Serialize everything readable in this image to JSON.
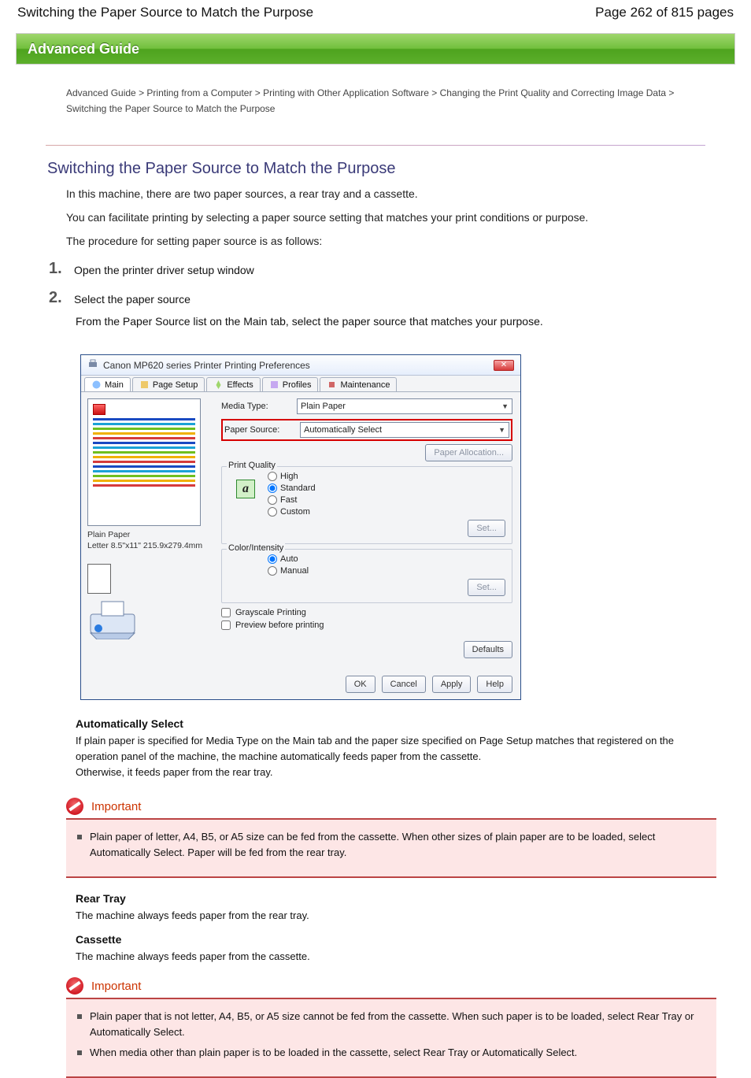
{
  "header": {
    "left": "Switching the Paper Source to Match the Purpose",
    "right": "Page 262 of 815 pages"
  },
  "guide_bar": "Advanced Guide",
  "breadcrumb": "Advanced Guide > Printing from a Computer > Printing with Other Application Software > Changing the Print Quality and Correcting Image Data > Switching the Paper Source to Match the Purpose",
  "page_title": "Switching the Paper Source to Match the Purpose",
  "intro": [
    "In this machine, there are two paper sources, a rear tray and a cassette.",
    "You can facilitate printing by selecting a paper source setting that matches your print conditions or purpose.",
    "The procedure for setting paper source is as follows:"
  ],
  "step1": {
    "num": "1.",
    "title": "Open the printer driver setup window"
  },
  "step2": {
    "num": "2.",
    "title": "Select the paper source",
    "desc": "From the Paper Source list on the Main tab, select the paper source that matches your purpose."
  },
  "dialog": {
    "title": "Canon MP620 series Printer Printing Preferences",
    "tabs": [
      "Main",
      "Page Setup",
      "Effects",
      "Profiles",
      "Maintenance"
    ],
    "media_type_label": "Media Type:",
    "media_type_value": "Plain Paper",
    "paper_source_label": "Paper Source:",
    "paper_source_value": "Automatically Select",
    "paper_allocation_btn": "Paper Allocation...",
    "print_quality_label": "Print Quality",
    "quality_options": [
      "High",
      "Standard",
      "Fast",
      "Custom"
    ],
    "set_btn": "Set...",
    "color_intensity_label": "Color/Intensity",
    "color_options": [
      "Auto",
      "Manual"
    ],
    "grayscale_label": "Grayscale Printing",
    "preview_label": "Preview before printing",
    "defaults_btn": "Defaults",
    "ok_btn": "OK",
    "cancel_btn": "Cancel",
    "apply_btn": "Apply",
    "help_btn": "Help",
    "preview_text_1": "Plain Paper",
    "preview_text_2": "Letter 8.5\"x11\" 215.9x279.4mm"
  },
  "auto_select": {
    "heading": "Automatically Select",
    "body1": "If plain paper is specified for Media Type on the Main tab and the paper size specified on Page Setup matches that registered on the operation panel of the machine, the machine automatically feeds paper from the cassette.",
    "body2": "Otherwise, it feeds paper from the rear tray."
  },
  "important1": {
    "title": "Important",
    "line1": "Plain paper of letter, A4, B5, or A5 size can be fed from the cassette. When other sizes of plain paper are to be loaded, select Automatically Select. Paper will be fed from the rear tray."
  },
  "rear_tray": {
    "heading": "Rear Tray",
    "body": "The machine always feeds paper from the rear tray."
  },
  "cassette": {
    "heading": "Cassette",
    "body": "The machine always feeds paper from the cassette."
  },
  "important2": {
    "title": "Important",
    "line1": "Plain paper that is not letter, A4, B5, or A5 size cannot be fed from the cassette. When such paper is to be loaded, select Rear Tray or Automatically Select.",
    "line2": "When media other than plain paper is to be loaded in the cassette, select Rear Tray or Automatically Select."
  }
}
